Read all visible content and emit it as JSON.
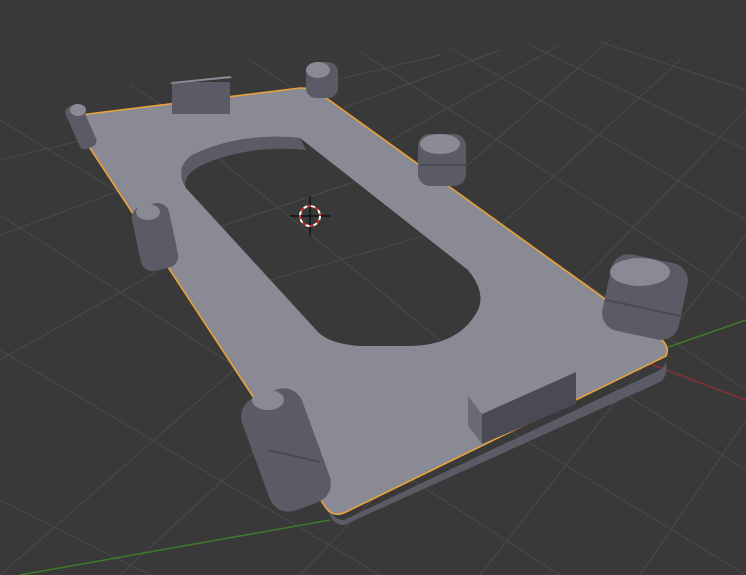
{
  "viewport": {
    "background": "#393939",
    "grid_color": "#4a4a4a",
    "axis_x_color": "#8a2f35",
    "axis_y_color": "#3f7a2a",
    "selection_outline_color": "#e8a23a"
  },
  "object": {
    "face_top": "#8a8a94",
    "face_side": "#5b5b66",
    "face_dark": "#4a4a54",
    "selected": true
  },
  "cursor_3d": {
    "ring_colors": [
      "#ffffff",
      "#d03030"
    ],
    "icon": "crosshair-icon"
  }
}
